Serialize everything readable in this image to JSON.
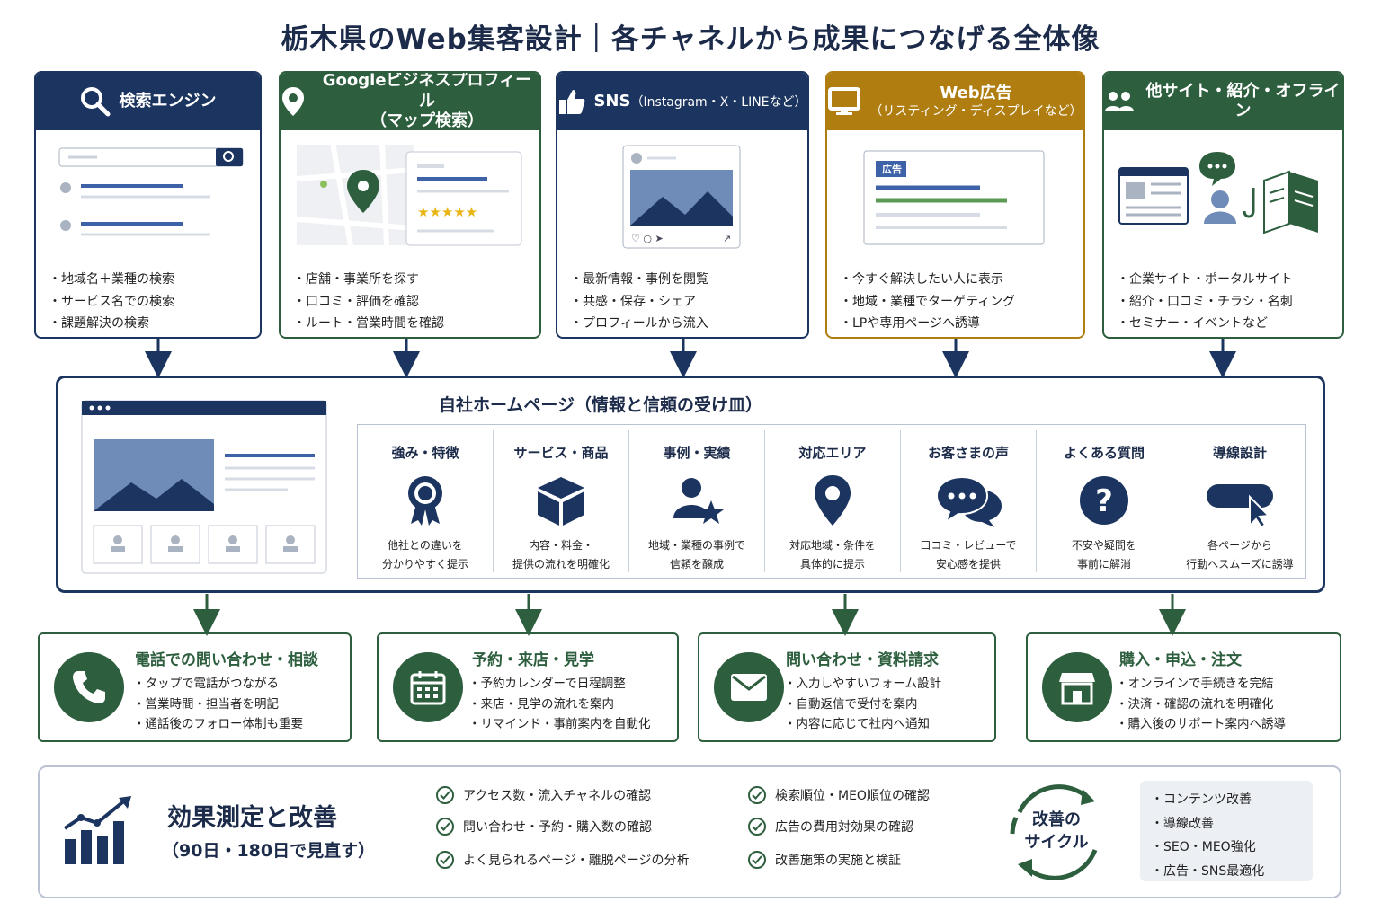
{
  "title": "栃木県のWeb集客設計｜各チャネルから成果につなげる全体像",
  "colors": {
    "navy": "#1c3560",
    "green": "#2d5e3e",
    "gold": "#b07d11"
  },
  "channels": [
    {
      "title": "検索エンジン",
      "subtitle": "",
      "icon": "search-icon",
      "bullets": [
        "地域名＋業種の検索",
        "サービス名での検索",
        "課題解決の検索"
      ]
    },
    {
      "title": "Googleビジネスプロフィール",
      "subtitle": "（マップ検索）",
      "icon": "map-pin-icon",
      "bullets": [
        "店舗・事業所を探す",
        "口コミ・評価を確認",
        "ルート・営業時間を確認"
      ]
    },
    {
      "title": "SNS",
      "subtitle": "（Instagram・X・LINEなど）",
      "icon": "thumbs-up-icon",
      "bullets": [
        "最新情報・事例を閲覧",
        "共感・保存・シェア",
        "プロフィールから流入"
      ]
    },
    {
      "title": "Web広告",
      "subtitle": "（リスティング・ディスプレイなど）",
      "icon": "monitor-icon",
      "ad_label": "広告",
      "bullets": [
        "今すぐ解決したい人に表示",
        "地域・業種でターゲティング",
        "LPや専用ページへ誘導"
      ]
    },
    {
      "title": "他サイト・紹介・オフライン",
      "subtitle": "",
      "icon": "users-icon",
      "bullets": [
        "企業サイト・ポータルサイト",
        "紹介・口コミ・チラシ・名刺",
        "セミナー・イベントなど"
      ]
    }
  ],
  "homepage": {
    "title": "自社ホームページ（情報と信頼の受け皿）",
    "features": [
      {
        "title": "強み・特徴",
        "icon": "award-icon",
        "desc1": "他社との違いを",
        "desc2": "分かりやすく提示"
      },
      {
        "title": "サービス・商品",
        "icon": "box-icon",
        "desc1": "内容・料金・",
        "desc2": "提供の流れを明確化"
      },
      {
        "title": "事例・実績",
        "icon": "user-star-icon",
        "desc1": "地域・業種の事例で",
        "desc2": "信頼を醸成"
      },
      {
        "title": "対応エリア",
        "icon": "location-icon",
        "desc1": "対応地域・条件を",
        "desc2": "具体的に提示"
      },
      {
        "title": "お客さまの声",
        "icon": "chat-bubbles-icon",
        "desc1": "口コミ・レビューで",
        "desc2": "安心感を提供"
      },
      {
        "title": "よくある質問",
        "icon": "question-icon",
        "desc1": "不安や疑問を",
        "desc2": "事前に解消"
      },
      {
        "title": "導線設計",
        "icon": "cursor-button-icon",
        "desc1": "各ページから",
        "desc2": "行動へスムーズに誘導"
      }
    ]
  },
  "conversions": [
    {
      "title": "電話での問い合わせ・相談",
      "icon": "phone-icon",
      "bullets": [
        "タップで電話がつながる",
        "営業時間・担当者を明記",
        "通話後のフォロー体制も重要"
      ]
    },
    {
      "title": "予約・来店・見学",
      "icon": "calendar-icon",
      "bullets": [
        "予約カレンダーで日程調整",
        "来店・見学の流れを案内",
        "リマインド・事前案内を自動化"
      ]
    },
    {
      "title": "問い合わせ・資料請求",
      "icon": "mail-icon",
      "bullets": [
        "入力しやすいフォーム設計",
        "自動返信で受付を案内",
        "内容に応じて社内へ通知"
      ]
    },
    {
      "title": "購入・申込・注文",
      "icon": "store-icon",
      "bullets": [
        "オンラインで手続きを完結",
        "決済・確認の流れを明確化",
        "購入後のサポート案内へ誘導"
      ]
    }
  ],
  "measurement": {
    "title": "効果測定と改善",
    "subtitle": "（90日・180日で見直す）",
    "checks_left": [
      "アクセス数・流入チャネルの確認",
      "問い合わせ・予約・購入数の確認",
      "よく見られるページ・離脱ページの分析"
    ],
    "checks_right": [
      "検索順位・MEO順位の確認",
      "広告の費用対効果の確認",
      "改善施策の実施と検証"
    ],
    "cycle_line1": "改善の",
    "cycle_line2": "サイクル",
    "improvements": [
      "コンテンツ改善",
      "導線改善",
      "SEO・MEO強化",
      "広告・SNS最適化"
    ]
  }
}
